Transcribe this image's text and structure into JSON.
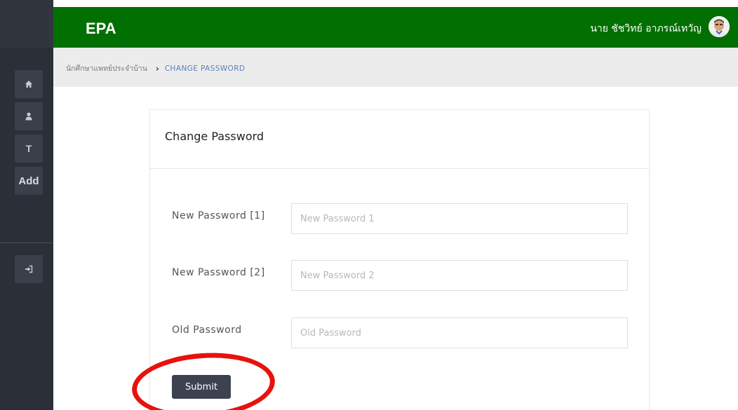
{
  "header": {
    "brand": "EPA",
    "user_name": "นาย ชัชวิทย์ อาภรณ์เทวัญ"
  },
  "sidebar": {
    "items": [
      {
        "icon": "home-icon"
      },
      {
        "icon": "user-icon"
      },
      {
        "label": "T"
      },
      {
        "label": "Add"
      },
      {
        "icon": "sign-in-icon"
      }
    ]
  },
  "breadcrumb": {
    "parent": "นักศึกษาแพทย์ประจำบ้าน",
    "current": "CHANGE PASSWORD"
  },
  "card": {
    "title": "Change Password",
    "fields": [
      {
        "label": "New Password [1]",
        "placeholder": "New Password 1",
        "value": ""
      },
      {
        "label": "New Password [2]",
        "placeholder": "New Password 2",
        "value": ""
      },
      {
        "label": "Old Password",
        "placeholder": "Old Password",
        "value": ""
      }
    ],
    "submit_label": "Submit"
  },
  "colors": {
    "header_green": "#016f01",
    "sidebar": "#2b2f38",
    "button": "#3d4250",
    "link": "#5b7fb9",
    "annotation": "#e8120c"
  }
}
